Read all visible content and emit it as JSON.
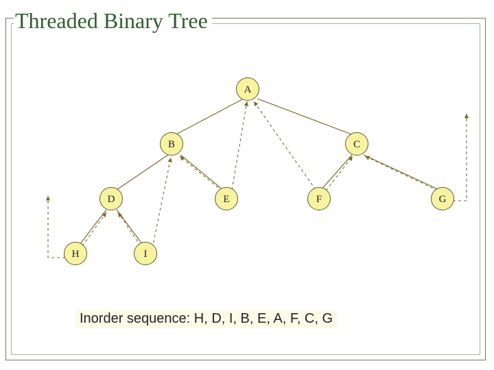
{
  "title": "Threaded Binary Tree",
  "nodes": {
    "A": "A",
    "B": "B",
    "C": "C",
    "D": "D",
    "E": "E",
    "F": "F",
    "G": "G",
    "H": "H",
    "I": "I"
  },
  "caption": "Inorder sequence: H, D, I, B, E, A, F, C, G",
  "chart_data": {
    "type": "tree",
    "title": "Threaded Binary Tree",
    "nodes": [
      "A",
      "B",
      "C",
      "D",
      "E",
      "F",
      "G",
      "H",
      "I"
    ],
    "tree_edges": [
      [
        "A",
        "B"
      ],
      [
        "A",
        "C"
      ],
      [
        "B",
        "D"
      ],
      [
        "B",
        "E"
      ],
      [
        "C",
        "F"
      ],
      [
        "C",
        "G"
      ],
      [
        "D",
        "H"
      ],
      [
        "D",
        "I"
      ]
    ],
    "thread_edges": [
      [
        "H",
        "D"
      ],
      [
        "I",
        "D"
      ],
      [
        "I",
        "B"
      ],
      [
        "E",
        "B"
      ],
      [
        "E",
        "A"
      ],
      [
        "F",
        "A"
      ],
      [
        "F",
        "C"
      ],
      [
        "G",
        "C"
      ],
      [
        "H",
        "null_left"
      ],
      [
        "G",
        "null_right"
      ]
    ],
    "inorder": [
      "H",
      "D",
      "I",
      "B",
      "E",
      "A",
      "F",
      "C",
      "G"
    ]
  }
}
